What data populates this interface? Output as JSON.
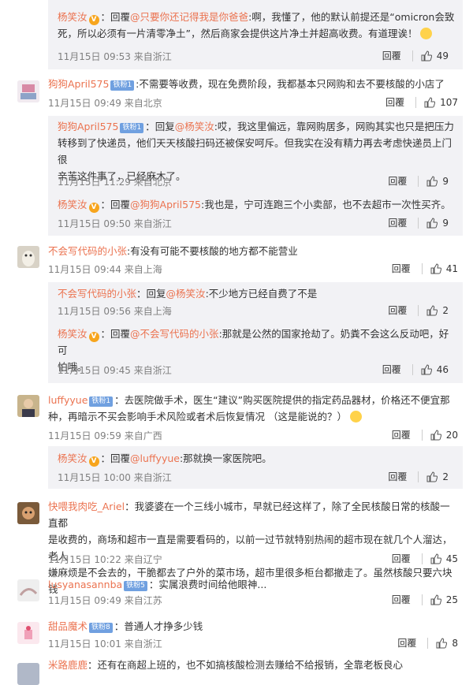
{
  "comments": [
    {
      "id": "c0",
      "nested": true,
      "name": "杨笑汝",
      "vip": true,
      "fan": "",
      "prefix": "回覆",
      "reply_to": "@只要你还记得我是你爸爸",
      "text_a": ":啊，我懂了，他的默认前提还是“omicron会致",
      "text_b": "死，所以必须有一片清零净土”，然后商家会提供这片净土并超高收费。有道理诶！",
      "time": "11月15日 09:53 来自浙江",
      "reply": "回覆",
      "likes": "49"
    },
    {
      "id": "c1",
      "nested": false,
      "name": "狗狗April575",
      "vip": false,
      "fan": "铁粉1",
      "prefix": "",
      "reply_to": "",
      "text_a": ":不需要等收费，现在免费阶段，我都基本只网购和去不要核酸的小店了",
      "text_b": "",
      "time": "11月15日 09:49 来自北京",
      "reply": "回覆",
      "likes": "107"
    },
    {
      "id": "c2",
      "nested": true,
      "name": "狗狗April575",
      "vip": false,
      "fan": "铁粉1",
      "prefix": "回复",
      "reply_to": "@杨笑汝",
      "text_a": ":哎，我这里偏远，靠网购居多，网购其实也只是把压力",
      "text_b": "转移到了快递员，他们天天核酸扫码还被保安呵斥。但我实在没有精力再去考虑快递员上门很",
      "text_c": "辛苦这件事了，已经麻木了。",
      "time": "11月15日 11:29 来自北京",
      "reply": "回覆",
      "likes": "9"
    },
    {
      "id": "c3",
      "nested": true,
      "name": "杨笑汝",
      "vip": true,
      "fan": "",
      "prefix": "回覆",
      "reply_to": "@狗狗April575",
      "text_a": ":我也是，宁可连跑三个小卖部，也不去超市一次性买齐。",
      "text_b": "",
      "time": "11月15日 09:50 来自浙江",
      "reply": "回覆",
      "likes": "9"
    },
    {
      "id": "c4",
      "nested": false,
      "name": "不会写代码的小张",
      "vip": false,
      "fan": "",
      "prefix": "",
      "reply_to": "",
      "text_a": ":有没有可能不要核酸的地方都不能营业",
      "text_b": "",
      "time": "11月15日 09:44 来自上海",
      "reply": "回覆",
      "likes": "41"
    },
    {
      "id": "c5",
      "nested": true,
      "name": "不会写代码的小张",
      "vip": false,
      "fan": "",
      "prefix": "回复",
      "reply_to": "@杨笑汝",
      "text_a": ":不少地方已经自费了不是",
      "text_b": "",
      "time": "11月15日 09:56 来自上海",
      "reply": "回覆",
      "likes": "2"
    },
    {
      "id": "c6",
      "nested": true,
      "name": "杨笑汝",
      "vip": true,
      "fan": "",
      "prefix": "回覆",
      "reply_to": "@不会写代码的小张",
      "text_a": ":那就是公然的国家抢劫了。奶粪不会这么反动吧，好可",
      "text_b": "怕哦。",
      "time": "11月15日 09:45 来自浙江",
      "reply": "回覆",
      "likes": "46"
    },
    {
      "id": "c7",
      "nested": false,
      "name": "luffyyue",
      "vip": false,
      "fan": "铁粉1",
      "prefix": "",
      "reply_to": "",
      "text_a": "：去医院做手术，医生“建议”购买医院提供的指定药品器材，价格还不便宜那",
      "text_b": "种，再暗示不买会影响手术风险或者术后恢复情况 （这是能说的？）",
      "time": "11月15日 09:59 来自广西",
      "reply": "回覆",
      "likes": "20"
    },
    {
      "id": "c8",
      "nested": true,
      "name": "杨笑汝",
      "vip": true,
      "fan": "",
      "prefix": "回覆",
      "reply_to": "@luffyyue",
      "text_a": ":那就换一家医院吧。",
      "text_b": "",
      "time": "11月15日 10:00 来自浙江",
      "reply": "回覆",
      "likes": "2"
    },
    {
      "id": "c9",
      "nested": false,
      "name": "快喂我肉吃_Ariel",
      "vip": false,
      "fan": "",
      "prefix": "",
      "reply_to": "",
      "text_a": "：我婆婆在一个三线小城市，早就已经这样了，除了全民核酸日常的核酸一直都",
      "text_b": "是收费的，商场和超市一直是需要看码的，以前一过节就特别热闹的超市现在就几个人溜达，老人",
      "text_c": "嫌麻烦是不会去的，干脆都去了户外的菜市场，超市里很多柜台都撤走了。虽然核酸只要六块钱",
      "time": "11月15日 10:22 来自辽宁",
      "reply": "回覆",
      "likes": "45"
    },
    {
      "id": "c10",
      "nested": false,
      "name": "lusyanasannba",
      "vip": false,
      "fan": "铁粉5",
      "prefix": "",
      "reply_to": "",
      "text_a": "：实属浪费时间给他眼神...",
      "text_b": "",
      "time": "11月15日 09:49 来自江苏",
      "reply": "回覆",
      "likes": "25"
    },
    {
      "id": "c11",
      "nested": false,
      "name": "甜品魔术",
      "vip": false,
      "fan": "铁粉8",
      "prefix": "",
      "reply_to": "",
      "text_a": "：普通人才挣多少钱",
      "text_b": "",
      "time": "11月15日 10:01 来自浙江",
      "reply": "回覆",
      "likes": "8"
    },
    {
      "id": "c12",
      "nested": false,
      "name": "米路鹿鹿",
      "vip": false,
      "fan": "",
      "prefix": "",
      "reply_to": "",
      "text_a": "：还有在商超上班的，也不如搞核酸检测去赚给不给报销，全靠老板良心",
      "text_b": "",
      "time": "",
      "reply": "",
      "likes": ""
    }
  ],
  "colors": {
    "name": "#eb7350",
    "meta": "#808080",
    "text": "#333333",
    "reply_bg": "#f2f2f5"
  }
}
